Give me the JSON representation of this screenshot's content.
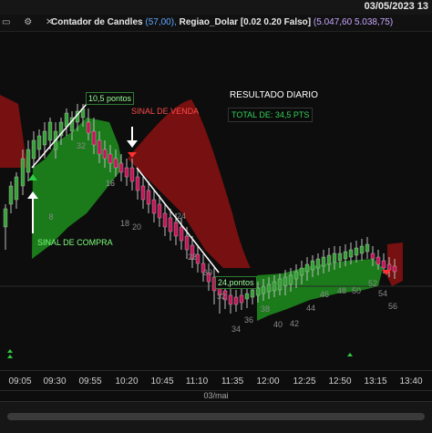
{
  "topbar": {
    "date": "03/05/2023 13"
  },
  "legend": {
    "icons": "▭ ⚙ ✕",
    "indicator_name": "Contador de Candles",
    "indicator_value": "(57,00),",
    "region_name": "Regiao_Dolar [0.02 0.20 Falso]",
    "region_values": "(5.047,60 5.038,75)"
  },
  "annotations": {
    "top_points": "10,5 pontos",
    "sell_signal": "SINAL DE VENDA",
    "buy_signal": "SINAL DE COMPRA",
    "low_points": "24,pontos",
    "result_title": "RESULTADO DIARIO",
    "result_total": "TOTAL DE: 34,5 PTS"
  },
  "candle_numbers": [
    "16",
    "8",
    "32",
    "16",
    "18",
    "20",
    "24",
    "28",
    "30",
    "32",
    "34",
    "36",
    "38",
    "40",
    "42",
    "44",
    "46",
    "48",
    "50",
    "52",
    "54",
    "56"
  ],
  "xaxis": {
    "ticks": [
      "09:05",
      "09:30",
      "09:55",
      "10:20",
      "10:45",
      "11:10",
      "11:35",
      "12:00",
      "12:25",
      "12:50",
      "13:15",
      "13:40"
    ]
  },
  "bottombar": {
    "day": "03/mai"
  },
  "colors": {
    "up_candle": "#3aa03a",
    "down_candle": "#c2185b",
    "sell_zone": "#8b1212",
    "buy_zone": "#1f8f1f"
  }
}
